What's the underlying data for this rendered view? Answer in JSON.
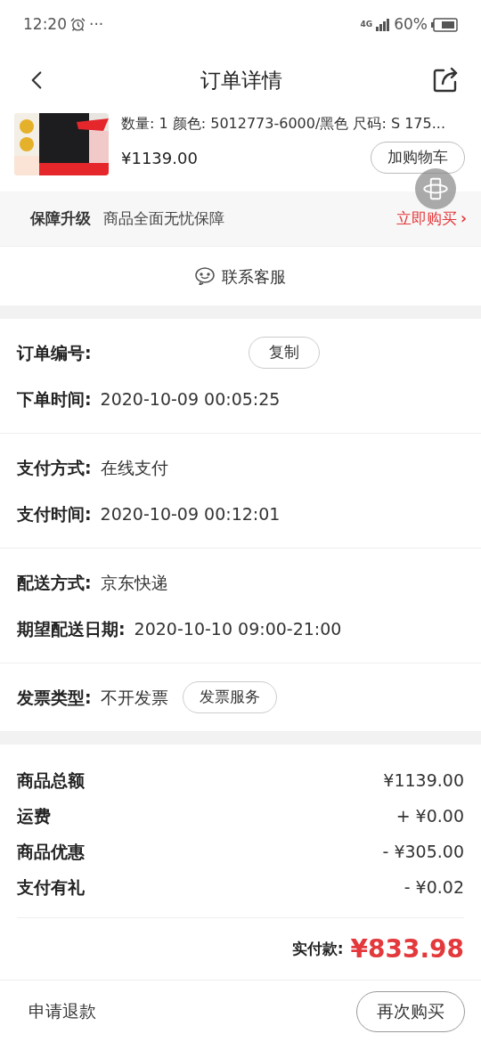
{
  "status_bar": {
    "time": "12:20",
    "dots": "···",
    "network": "4G",
    "battery": "60%"
  },
  "header": {
    "title": "订单详情"
  },
  "product": {
    "specs": "数量: 1 颜色: 5012773-6000/黑色 尺码: S   175...",
    "price": "¥1139.00",
    "cart_button": "加购物车"
  },
  "guarantee": {
    "title": "保障升级",
    "description": "商品全面无忧保障",
    "action": "立即购买",
    "action_arrow": "›"
  },
  "contact": {
    "label": "联系客服"
  },
  "info_groups": [
    {
      "rows": [
        {
          "label": "订单编号:",
          "button": "复制"
        },
        {
          "label": "下单时间:",
          "value": "2020-10-09 00:05:25"
        }
      ]
    },
    {
      "rows": [
        {
          "label": "支付方式:",
          "value": "在线支付"
        },
        {
          "label": "支付时间:",
          "value": "2020-10-09 00:12:01"
        }
      ]
    },
    {
      "rows": [
        {
          "label": "配送方式:",
          "value": "京东快递"
        },
        {
          "label": "期望配送日期:",
          "value": "2020-10-10 09:00-21:00"
        }
      ]
    },
    {
      "rows": [
        {
          "label": "发票类型:",
          "value": "不开发票",
          "button": "发票服务"
        }
      ]
    }
  ],
  "totals": [
    {
      "label": "商品总额",
      "value": "¥1139.00"
    },
    {
      "label": "运费",
      "value": "+ ¥0.00"
    },
    {
      "label": "商品优惠",
      "value": "- ¥305.00"
    },
    {
      "label": "支付有礼",
      "value": "- ¥0.02"
    }
  ],
  "paid": {
    "label": "实付款:",
    "value": "¥833.98"
  },
  "footer": {
    "refund": "申请退款",
    "rebuy": "再次购买"
  }
}
